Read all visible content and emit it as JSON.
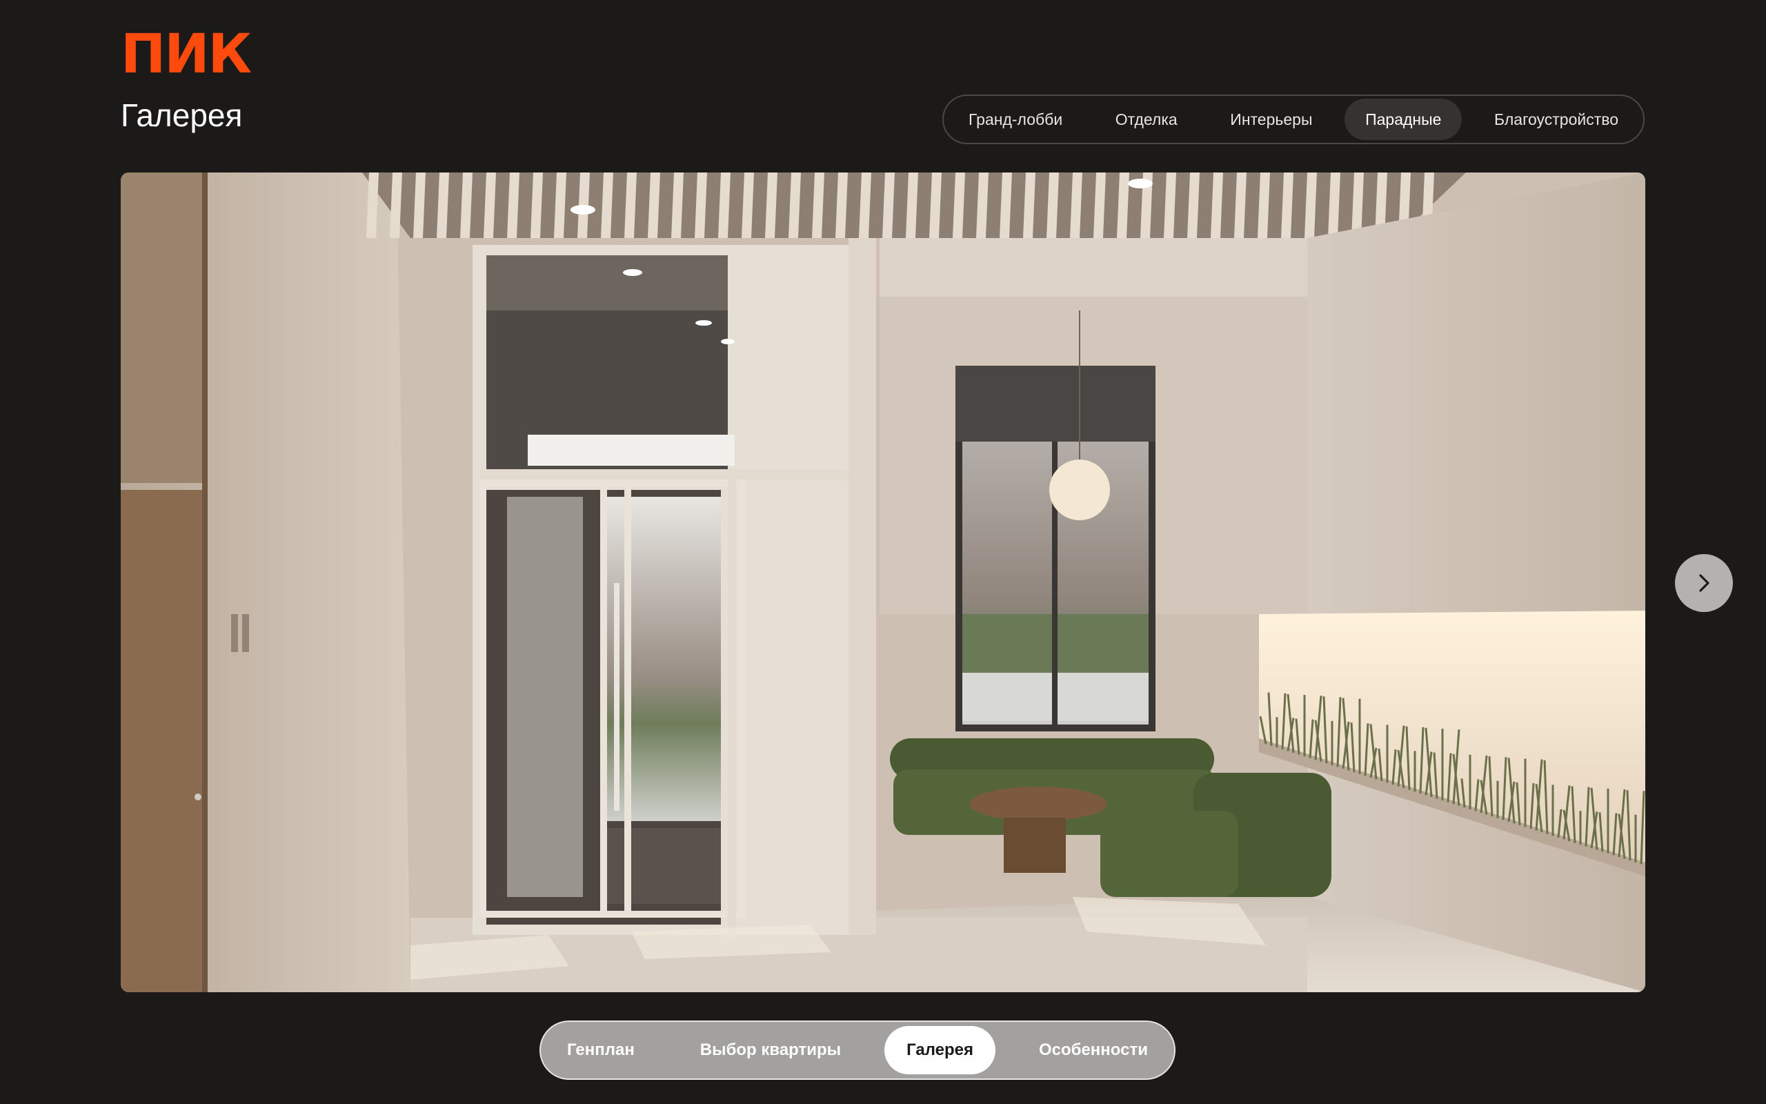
{
  "brand": {
    "logo_text": "ПИК",
    "color": "#ff4a0d"
  },
  "page": {
    "title": "Галерея"
  },
  "top_tabs": [
    {
      "label": "Гранд-лобби",
      "active": false
    },
    {
      "label": "Отделка",
      "active": false
    },
    {
      "label": "Интерьеры",
      "active": false
    },
    {
      "label": "Парадные",
      "active": true
    },
    {
      "label": "Благоустройство",
      "active": false
    }
  ],
  "gallery": {
    "next_icon": "chevron-right-icon"
  },
  "bottom_nav": [
    {
      "label": "Генплан",
      "active": false
    },
    {
      "label": "Выбор квартиры",
      "active": false
    },
    {
      "label": "Галерея",
      "active": true
    },
    {
      "label": "Особенности",
      "active": false
    }
  ],
  "colors": {
    "background": "#1c1a19",
    "accent": "#ff4a0d",
    "active_tab_bg": "#353230"
  }
}
